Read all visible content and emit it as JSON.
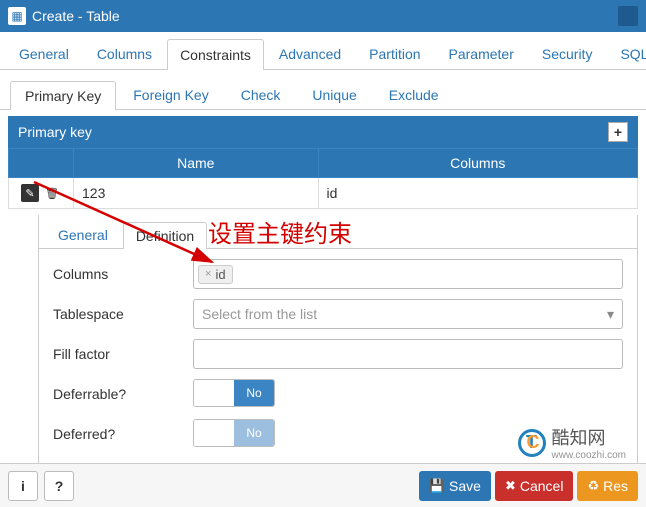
{
  "window": {
    "title": "Create - Table"
  },
  "main_tabs": [
    "General",
    "Columns",
    "Constraints",
    "Advanced",
    "Partition",
    "Parameter",
    "Security",
    "SQL"
  ],
  "main_tab_active": 2,
  "sub_tabs": [
    "Primary Key",
    "Foreign Key",
    "Check",
    "Unique",
    "Exclude"
  ],
  "sub_tab_active": 0,
  "grid": {
    "title": "Primary key",
    "headers": [
      "Name",
      "Columns"
    ],
    "rows": [
      {
        "name": "123",
        "columns": "id"
      }
    ]
  },
  "detail": {
    "tabs": [
      "General",
      "Definition"
    ],
    "active": 1,
    "form": {
      "columns_label": "Columns",
      "columns_tags": [
        "id"
      ],
      "tablespace_label": "Tablespace",
      "tablespace_placeholder": "Select from the list",
      "fillfactor_label": "Fill factor",
      "fillfactor_value": "",
      "deferrable_label": "Deferrable?",
      "deferrable_value": "No",
      "deferred_label": "Deferred?",
      "deferred_value": "No"
    }
  },
  "annotation": {
    "text": "设置主键约束"
  },
  "footer": {
    "info": "i",
    "help": "?",
    "save": "Save",
    "cancel": "Cancel",
    "reset": "Res"
  },
  "watermark": {
    "cn": "酷知网",
    "en": "www.coozhi.com"
  }
}
